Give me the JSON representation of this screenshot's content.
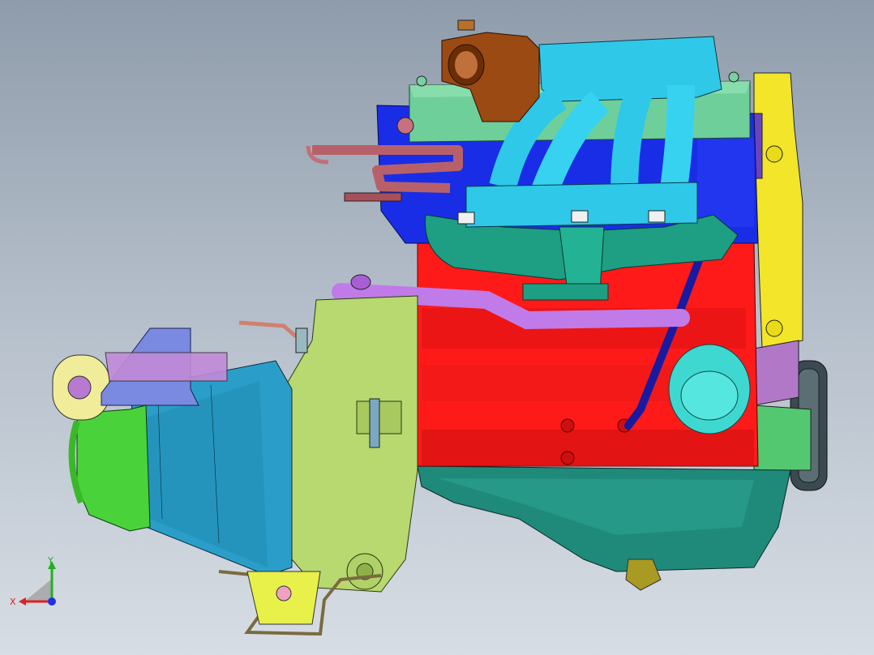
{
  "viewport": {
    "background_top": "#8f9cab",
    "background_bottom": "#d7dde4"
  },
  "model": {
    "part_colors": {
      "engine_block": "#ff1a1a",
      "cylinder_head": "#1a2de6",
      "valve_cover": "#6fcf9a",
      "intake_manifold": "#2fc8e8",
      "exhaust_manifold": "#1e9e82",
      "throttle_body": "#9a4a12",
      "timing_cover": "#f2e52a",
      "oil_pan": "#1f8a7a",
      "gearbox_housing": "#b8d870",
      "bellhousing": "#2a9ec8",
      "gearbox_end_cover": "#4ad23a",
      "oil_filter": "#3fd8d0",
      "coolant_pipe": "#c07be8",
      "dipstick_tube": "#1a1aa0",
      "fuel_rail": "#b8606a",
      "mount_bracket": "#e8f04a"
    }
  },
  "triad": {
    "x_label": "X",
    "y_label": "Y",
    "x_color": "#e02020",
    "y_color": "#20b020",
    "z_color": "#2030e0"
  }
}
